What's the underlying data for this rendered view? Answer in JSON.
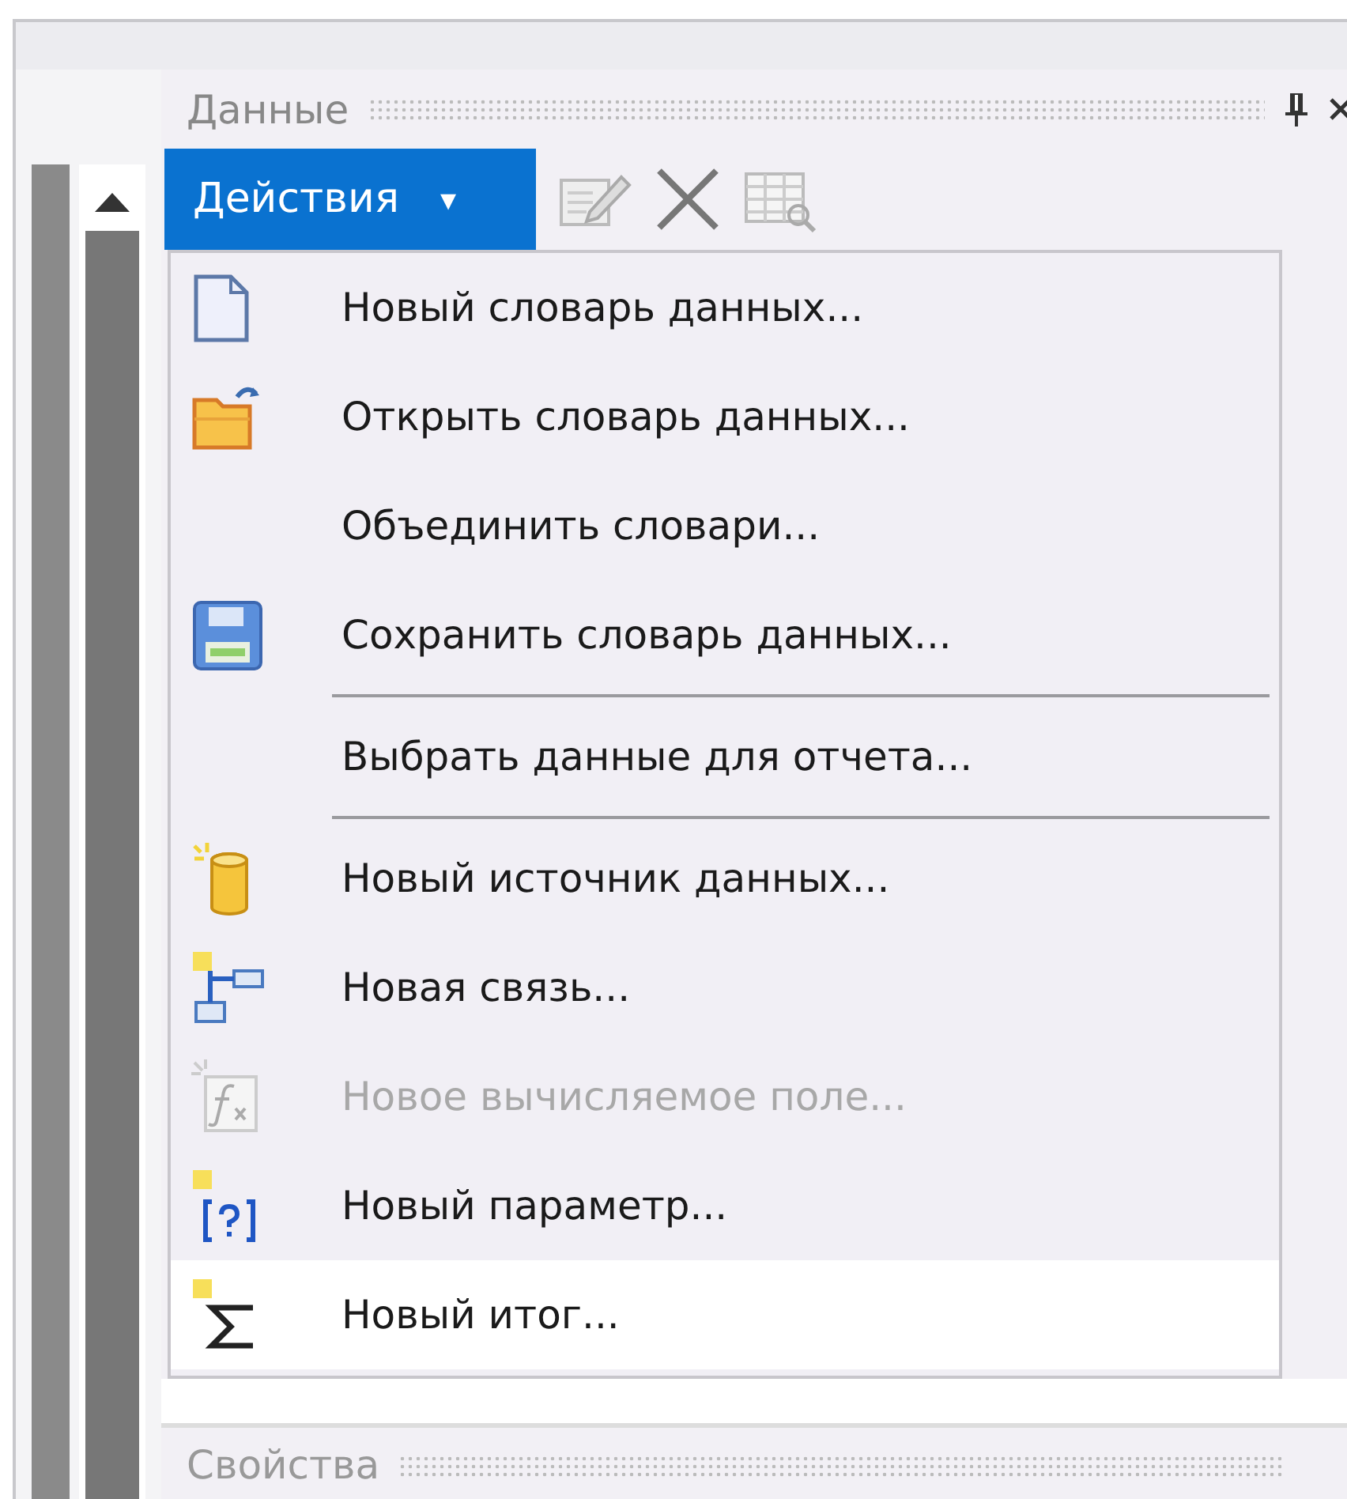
{
  "panel": {
    "title": "Данные"
  },
  "toolbar": {
    "actions_button": {
      "label": "Действия",
      "caret": "▾"
    }
  },
  "menu": {
    "items": [
      {
        "kind": "item",
        "label": "Новый словарь данных...",
        "disabled": false,
        "selected": false
      },
      {
        "kind": "item",
        "label": "Открыть словарь данных...",
        "disabled": false,
        "selected": false
      },
      {
        "kind": "item",
        "label": "Объединить словари...",
        "disabled": false,
        "selected": false
      },
      {
        "kind": "item",
        "label": "Сохранить словарь данных...",
        "disabled": false,
        "selected": false
      },
      {
        "kind": "separator"
      },
      {
        "kind": "item",
        "label": "Выбрать данные для отчета...",
        "disabled": false,
        "selected": false
      },
      {
        "kind": "separator"
      },
      {
        "kind": "item",
        "label": "Новый источник данных...",
        "disabled": false,
        "selected": false
      },
      {
        "kind": "item",
        "label": "Новая связь...",
        "disabled": false,
        "selected": false
      },
      {
        "kind": "item",
        "label": "Новое вычисляемое поле...",
        "disabled": true,
        "selected": false
      },
      {
        "kind": "item",
        "label": "Новый параметр...",
        "disabled": false,
        "selected": false
      },
      {
        "kind": "item",
        "label": "Новый итог...",
        "disabled": false,
        "selected": true
      }
    ]
  },
  "bottom_panel": {
    "title": "Свойства"
  }
}
